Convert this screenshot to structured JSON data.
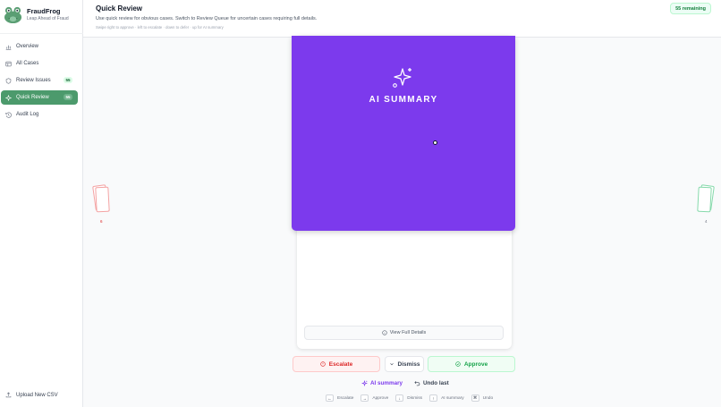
{
  "brand": {
    "name": "FraudFrog",
    "tagline": "Leap Ahead of Fraud"
  },
  "sidebar": {
    "items": [
      {
        "label": "Overview",
        "icon": "bar-chart-icon"
      },
      {
        "label": "All Cases",
        "icon": "table-icon"
      },
      {
        "label": "Review Issues",
        "icon": "shield-icon",
        "badge": "55"
      },
      {
        "label": "Quick Review",
        "icon": "sparkle-icon",
        "badge": "55",
        "active": true
      },
      {
        "label": "Audit Log",
        "icon": "history-icon"
      }
    ],
    "upload_label": "Upload New CSV"
  },
  "header": {
    "title": "Quick Review",
    "subtitle": "Use quick review for obvious cases. Switch to Review Queue for uncertain cases requiring full details.",
    "hint": "Swipe right to approve · left to escalate · down to defer · up for AI summary",
    "remaining": "55 remaining"
  },
  "stacks": {
    "left_count": "6",
    "right_count": "4"
  },
  "card": {
    "ai_summary_label": "AI SUMMARY",
    "view_details_label": "View Full Details"
  },
  "actions": {
    "escalate": "Escalate",
    "dismiss": "Dismiss",
    "approve": "Approve",
    "ai_summary": "AI summary",
    "undo": "Undo last"
  },
  "shortcuts": [
    {
      "key": "←",
      "label": "Escalate"
    },
    {
      "key": "→",
      "label": "Approve"
    },
    {
      "key": "↓",
      "label": "Dismiss"
    },
    {
      "key": "↑",
      "label": "AI summary"
    },
    {
      "key": "⌘",
      "label": "Undo"
    }
  ],
  "colors": {
    "accent": "#4c9a6c",
    "ai_purple": "#7c3aed",
    "escalate_red": "#dc2626",
    "approve_green": "#16a34a"
  }
}
